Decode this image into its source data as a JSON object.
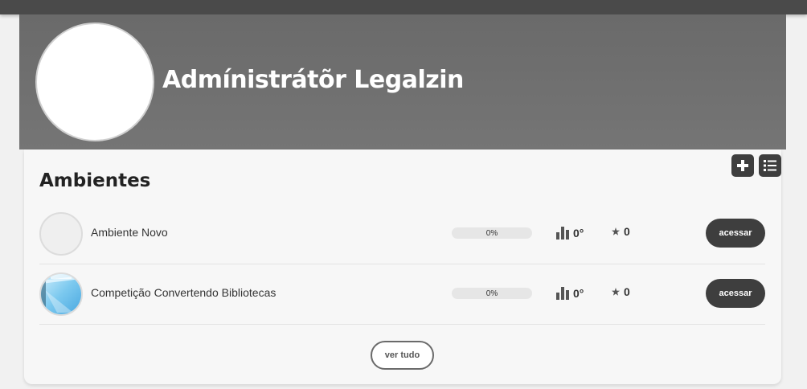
{
  "profile": {
    "name": "Admínistrátõr Legalzin"
  },
  "section": {
    "title": "Ambientes",
    "actions": [
      {
        "icon": "plus-icon"
      },
      {
        "icon": "list-icon"
      }
    ]
  },
  "environments": [
    {
      "name": "Ambiente Novo",
      "progress": 0,
      "progress_label": "0%",
      "level": "0°",
      "stars": "0",
      "button": "acessar"
    },
    {
      "name": "Competição Convertendo Bibliotecas",
      "progress": 0,
      "progress_label": "0%",
      "level": "0°",
      "stars": "0",
      "button": "acessar"
    }
  ],
  "see_all": "ver tudo",
  "colors": {
    "topbar": "#4a4a4a",
    "banner": "#757575",
    "button": "#3e3e3e",
    "background": "#f1f1f1"
  }
}
